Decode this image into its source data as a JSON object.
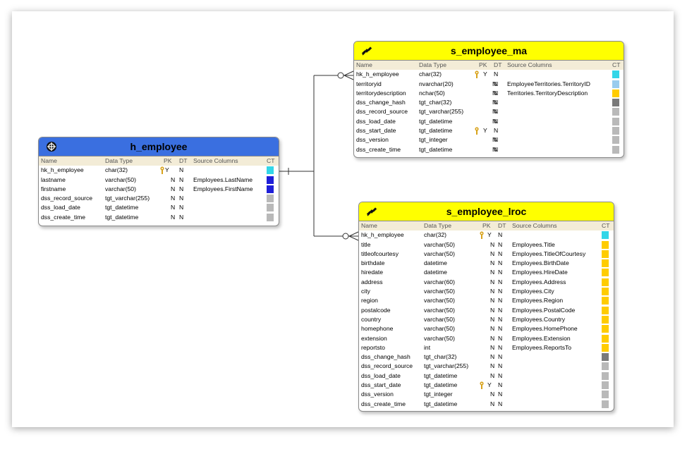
{
  "colors": {
    "hub_header": "#3a6fe0",
    "sat_header": "#ffff00",
    "column_header_bg": "#f3ecd7",
    "ct_cyan": "#33d6e8",
    "ct_lightblue": "#99ccee",
    "ct_blue": "#1f1fd8",
    "ct_yellow": "#ffcc00",
    "ct_darkgray": "#7a7a7a",
    "ct_gray": "#b9b9b9",
    "key": "#d8a31c"
  },
  "column_headers": {
    "name": "Name",
    "data_type": "Data Type",
    "pk": "PK",
    "dt": "DT",
    "source": "Source Columns",
    "ct": "CT"
  },
  "tables": {
    "h_employee": {
      "title": "h_employee",
      "icon": "globe-icon",
      "rows": [
        {
          "name": "hk_h_employee",
          "type": "char(32)",
          "key": true,
          "pk": "Y",
          "dt": "N",
          "source": "",
          "ct": "cyan"
        },
        {
          "name": "lastname",
          "type": "varchar(50)",
          "key": false,
          "pk": "N",
          "dt": "N",
          "source": "Employees.LastName",
          "ct": "blue"
        },
        {
          "name": "firstname",
          "type": "varchar(50)",
          "key": false,
          "pk": "N",
          "dt": "N",
          "source": "Employees.FirstName",
          "ct": "blue"
        },
        {
          "name": "dss_record_source",
          "type": "tgt_varchar(255)",
          "key": false,
          "pk": "N",
          "dt": "N",
          "source": "",
          "ct": "gray"
        },
        {
          "name": "dss_load_date",
          "type": "tgt_datetime",
          "key": false,
          "pk": "N",
          "dt": "N",
          "source": "",
          "ct": "gray"
        },
        {
          "name": "dss_create_time",
          "type": "tgt_datetime",
          "key": false,
          "pk": "N",
          "dt": "N",
          "source": "",
          "ct": "gray"
        }
      ]
    },
    "s_employee_ma": {
      "title": "s_employee_ma",
      "icon": "satellite-icon",
      "rows": [
        {
          "name": "hk_h_employee",
          "type": "char(32)",
          "key": true,
          "pk": "Y",
          "dt": "N",
          "source": "",
          "ct": "cyan"
        },
        {
          "name": "territoryid",
          "type": "nvarchar(20)",
          "key": false,
          "pk": "N",
          "dt": "N",
          "source": "EmployeeTerritories.TerritoryID",
          "ct": "lightblue"
        },
        {
          "name": "territorydescription",
          "type": "nchar(50)",
          "key": false,
          "pk": "N",
          "dt": "N",
          "source": "Territories.TerritoryDescription",
          "ct": "yellow"
        },
        {
          "name": "dss_change_hash",
          "type": "tgt_char(32)",
          "key": false,
          "pk": "N",
          "dt": "N",
          "source": "",
          "ct": "darkgray"
        },
        {
          "name": "dss_record_source",
          "type": "tgt_varchar(255)",
          "key": false,
          "pk": "N",
          "dt": "N",
          "source": "",
          "ct": "gray"
        },
        {
          "name": "dss_load_date",
          "type": "tgt_datetime",
          "key": false,
          "pk": "N",
          "dt": "N",
          "source": "",
          "ct": "gray"
        },
        {
          "name": "dss_start_date",
          "type": "tgt_datetime",
          "key": true,
          "pk": "Y",
          "dt": "N",
          "source": "",
          "ct": "gray"
        },
        {
          "name": "dss_version",
          "type": "tgt_integer",
          "key": false,
          "pk": "N",
          "dt": "N",
          "source": "",
          "ct": "gray"
        },
        {
          "name": "dss_create_time",
          "type": "tgt_datetime",
          "key": false,
          "pk": "N",
          "dt": "N",
          "source": "",
          "ct": "gray"
        }
      ]
    },
    "s_employee_lroc": {
      "title": "s_employee_lroc",
      "icon": "satellite-icon",
      "rows": [
        {
          "name": "hk_h_employee",
          "type": "char(32)",
          "key": true,
          "pk": "Y",
          "dt": "N",
          "source": "",
          "ct": "cyan"
        },
        {
          "name": "title",
          "type": "varchar(50)",
          "key": false,
          "pk": "N",
          "dt": "N",
          "source": "Employees.Title",
          "ct": "yellow"
        },
        {
          "name": "titleofcourtesy",
          "type": "varchar(50)",
          "key": false,
          "pk": "N",
          "dt": "N",
          "source": "Employees.TitleOfCourtesy",
          "ct": "yellow"
        },
        {
          "name": "birthdate",
          "type": "datetime",
          "key": false,
          "pk": "N",
          "dt": "N",
          "source": "Employees.BirthDate",
          "ct": "yellow"
        },
        {
          "name": "hiredate",
          "type": "datetime",
          "key": false,
          "pk": "N",
          "dt": "N",
          "source": "Employees.HireDate",
          "ct": "yellow"
        },
        {
          "name": "address",
          "type": "varchar(60)",
          "key": false,
          "pk": "N",
          "dt": "N",
          "source": "Employees.Address",
          "ct": "yellow"
        },
        {
          "name": "city",
          "type": "varchar(50)",
          "key": false,
          "pk": "N",
          "dt": "N",
          "source": "Employees.City",
          "ct": "yellow"
        },
        {
          "name": "region",
          "type": "varchar(50)",
          "key": false,
          "pk": "N",
          "dt": "N",
          "source": "Employees.Region",
          "ct": "yellow"
        },
        {
          "name": "postalcode",
          "type": "varchar(50)",
          "key": false,
          "pk": "N",
          "dt": "N",
          "source": "Employees.PostalCode",
          "ct": "yellow"
        },
        {
          "name": "country",
          "type": "varchar(50)",
          "key": false,
          "pk": "N",
          "dt": "N",
          "source": "Employees.Country",
          "ct": "yellow"
        },
        {
          "name": "homephone",
          "type": "varchar(50)",
          "key": false,
          "pk": "N",
          "dt": "N",
          "source": "Employees.HomePhone",
          "ct": "yellow"
        },
        {
          "name": "extension",
          "type": "varchar(50)",
          "key": false,
          "pk": "N",
          "dt": "N",
          "source": "Employees.Extension",
          "ct": "yellow"
        },
        {
          "name": "reportsto",
          "type": "int",
          "key": false,
          "pk": "N",
          "dt": "N",
          "source": "Employees.ReportsTo",
          "ct": "yellow"
        },
        {
          "name": "dss_change_hash",
          "type": "tgt_char(32)",
          "key": false,
          "pk": "N",
          "dt": "N",
          "source": "",
          "ct": "darkgray"
        },
        {
          "name": "dss_record_source",
          "type": "tgt_varchar(255)",
          "key": false,
          "pk": "N",
          "dt": "N",
          "source": "",
          "ct": "gray"
        },
        {
          "name": "dss_load_date",
          "type": "tgt_datetime",
          "key": false,
          "pk": "N",
          "dt": "N",
          "source": "",
          "ct": "gray"
        },
        {
          "name": "dss_start_date",
          "type": "tgt_datetime",
          "key": true,
          "pk": "Y",
          "dt": "N",
          "source": "",
          "ct": "gray"
        },
        {
          "name": "dss_version",
          "type": "tgt_integer",
          "key": false,
          "pk": "N",
          "dt": "N",
          "source": "",
          "ct": "gray"
        },
        {
          "name": "dss_create_time",
          "type": "tgt_datetime",
          "key": false,
          "pk": "N",
          "dt": "N",
          "source": "",
          "ct": "gray"
        }
      ]
    }
  }
}
